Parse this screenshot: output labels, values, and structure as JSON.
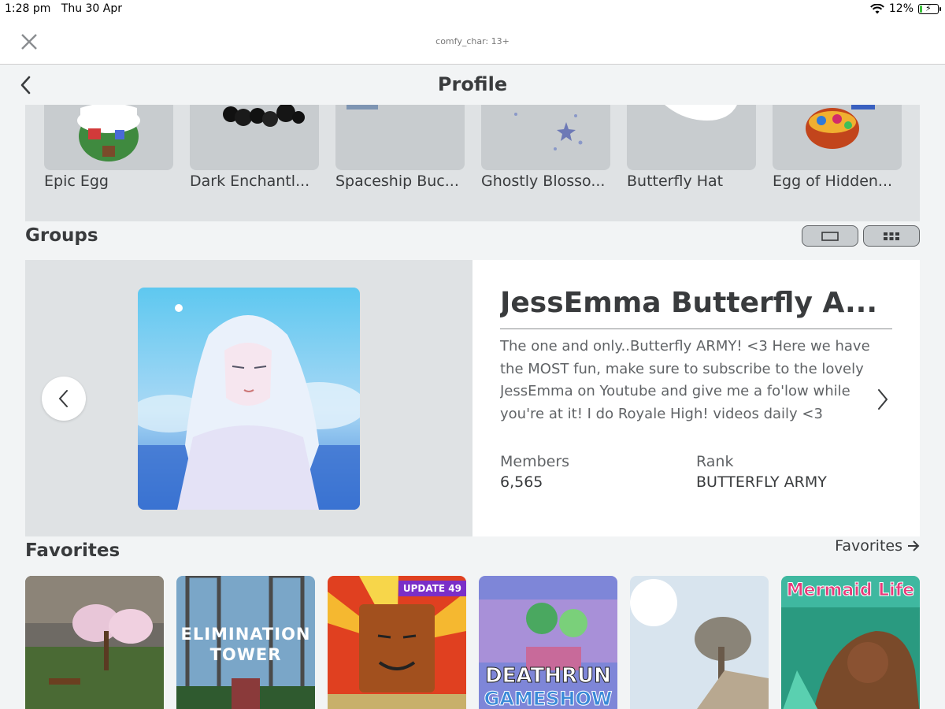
{
  "status_bar": {
    "time": "1:28 pm",
    "date": "Thu 30 Apr",
    "battery": "12%",
    "battery_level": 0.12
  },
  "web_bar": {
    "title": "comfy_char: 13+",
    "close_icon": "close-icon"
  },
  "header": {
    "title": "Profile",
    "back_icon": "chevron-left-icon"
  },
  "items": [
    {
      "name": "Epic Egg"
    },
    {
      "name": "Dark Enchantl..."
    },
    {
      "name": "Spaceship Buc..."
    },
    {
      "name": "Ghostly Blosso..."
    },
    {
      "name": "Butterfly Hat"
    },
    {
      "name": "Egg of Hidden..."
    }
  ],
  "groups": {
    "title": "Groups",
    "view_toggle": [
      "single-view-icon",
      "grid-view-icon"
    ],
    "card": {
      "name": "JessEmma Butterfly A...",
      "description": "The one and only..Butterfly ARMY! <3 Here we have the MOST fun, make sure to subscribe to the lovely JessEmma on Youtube and give me a fo'low while you're at it! I do Royale High! videos daily <3",
      "members_label": "Members",
      "members_value": "6,565",
      "rank_label": "Rank",
      "rank_value": "BUTTERFLY ARMY"
    }
  },
  "favorites": {
    "title": "Favorites",
    "link_label": "Favorites",
    "tiles": [
      {
        "text": ""
      },
      {
        "text": "ELIMINATION TOWER",
        "line1": "ELIMINATION",
        "line2": "TOWER"
      },
      {
        "text": "UPDATE 49",
        "badge": "UPDATE 49"
      },
      {
        "text": "DEATHRUN GAMESHOW",
        "line1": "DEATHRUN",
        "line2": "GAMESHOW"
      },
      {
        "text": ""
      },
      {
        "text": "Mermaid Life",
        "line1": "Mermaid Life"
      }
    ]
  },
  "colors": {
    "background": "#f2f4f5",
    "card": "#dfe2e4",
    "text": "#393b3d",
    "battery_green": "#3ac13a"
  }
}
